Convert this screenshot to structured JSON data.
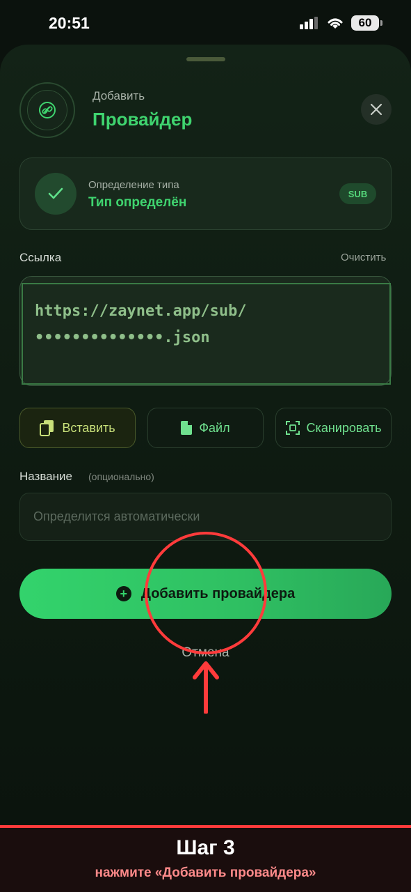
{
  "status_bar": {
    "time": "20:51",
    "battery": "60"
  },
  "header": {
    "subtitle": "Добавить",
    "title": "Провайдер"
  },
  "type_card": {
    "label": "Определение типа",
    "value": "Тип определён",
    "badge": "SUB"
  },
  "link": {
    "label": "Ссылка",
    "clear_label": "Очистить",
    "url_line1": "https://zaynet.app/sub/",
    "url_line2": "••••••••••••••.json"
  },
  "actions": {
    "paste": "Вставить",
    "file": "Файл",
    "scan": "Сканировать"
  },
  "name": {
    "label": "Название",
    "optional": "(опционально)",
    "placeholder": "Определится автоматически",
    "value": ""
  },
  "primary_button": "Добавить провайдера",
  "cancel": "Отмена",
  "annotation": {
    "step_title": "Шаг 3",
    "step_text": "нажмите «Добавить провайдера»"
  },
  "colors": {
    "accent": "#3fd46f",
    "annotation": "#ff3b3b"
  },
  "icons": [
    "link-icon",
    "close-icon",
    "check-icon",
    "paste-icon",
    "file-icon",
    "qr-scan-icon",
    "plus-circle-icon",
    "arrow-up-icon"
  ]
}
